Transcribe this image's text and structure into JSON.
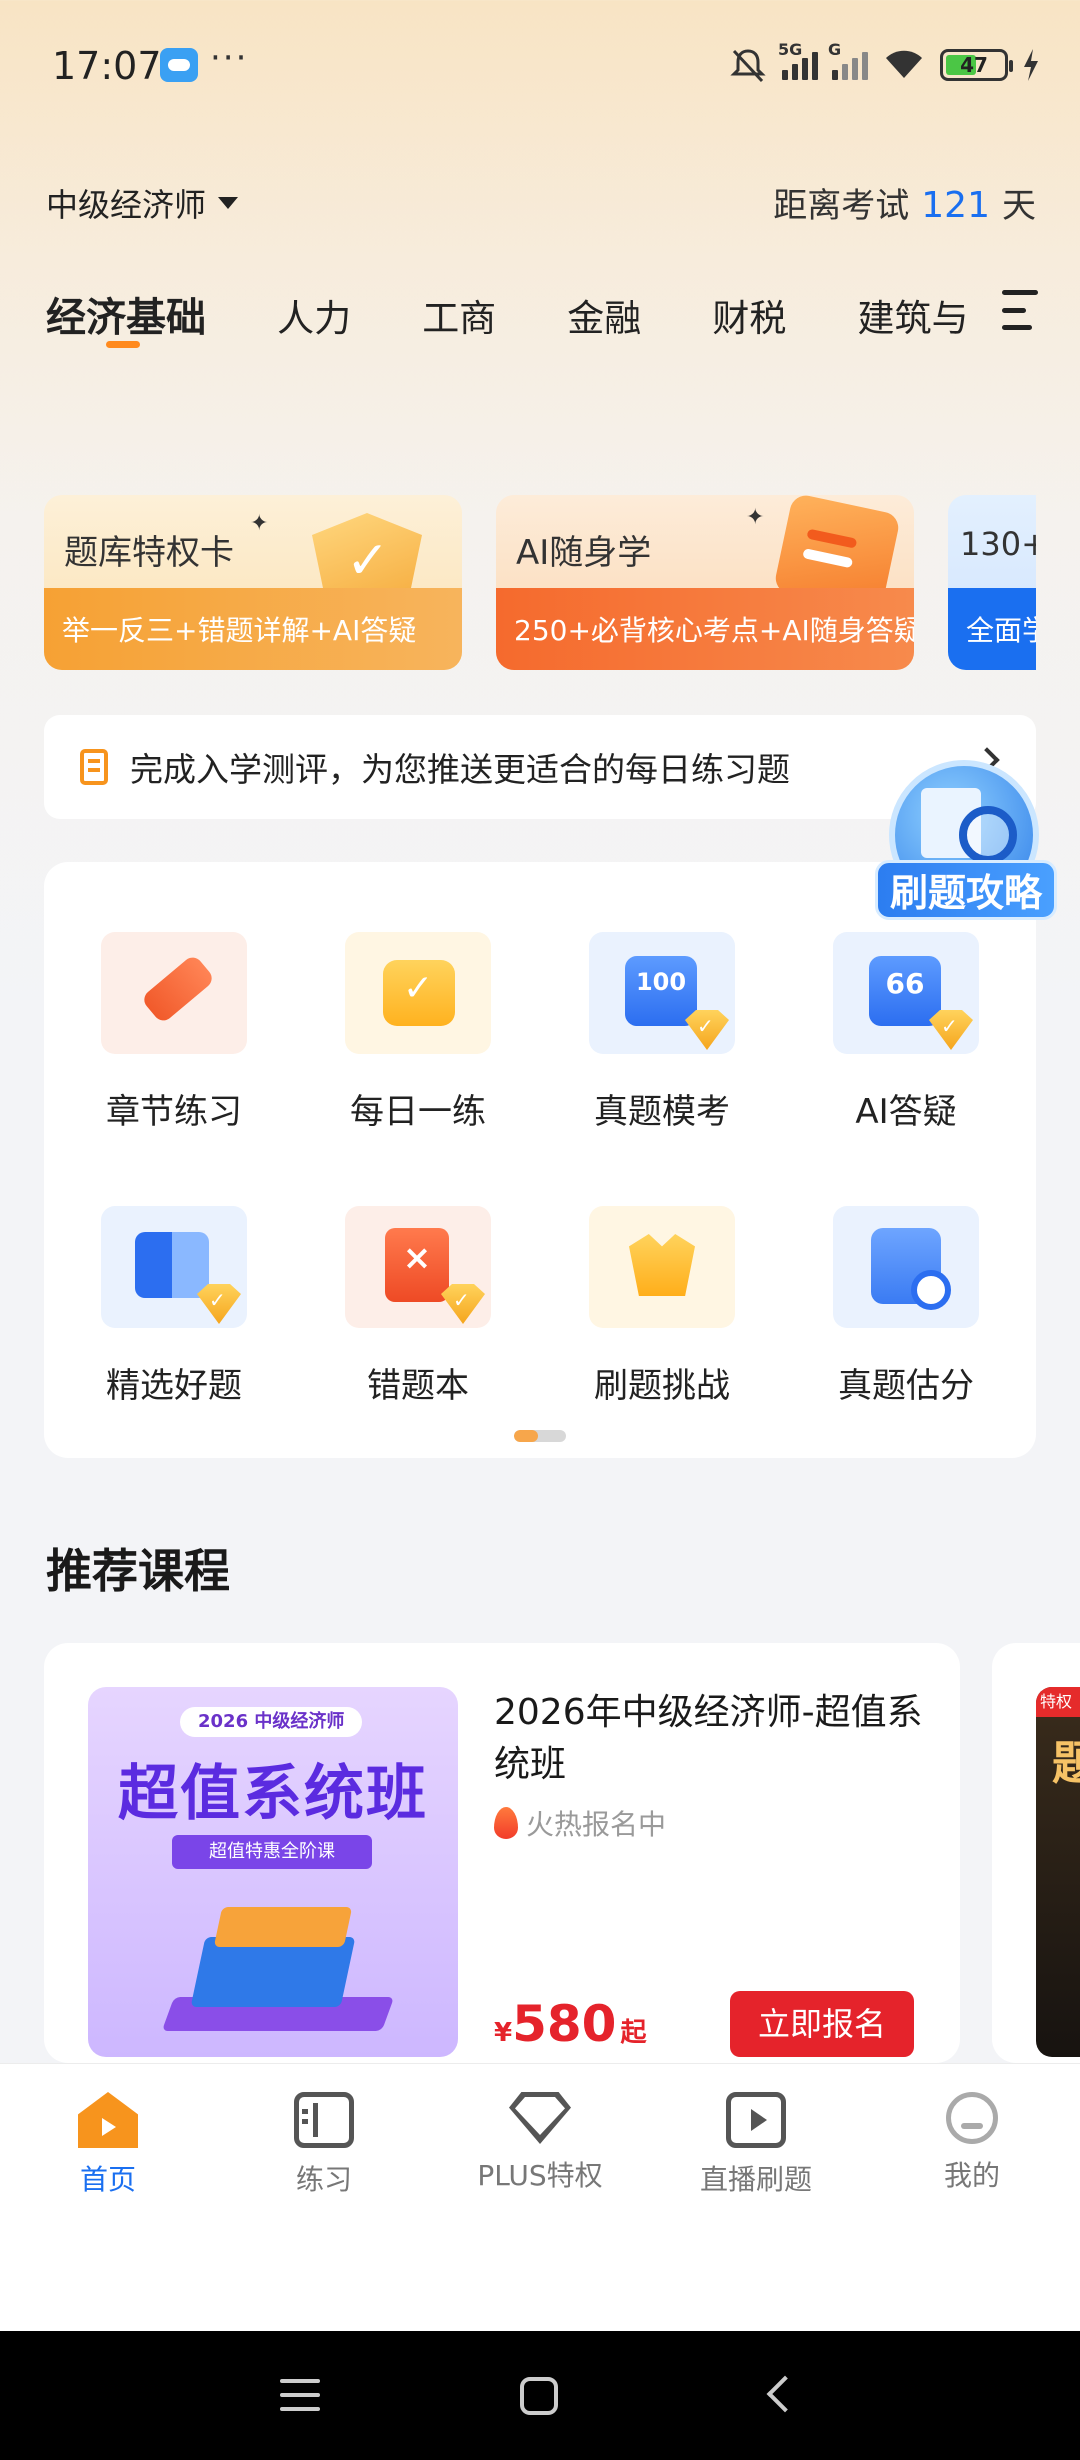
{
  "status_bar": {
    "time": "17:07",
    "more": "···",
    "network": "5G",
    "network2": "G",
    "battery": "47",
    "icons": [
      "cloud-icon",
      "mute-icon",
      "signal-icon",
      "wifi-icon",
      "battery-icon",
      "charging-icon"
    ]
  },
  "header": {
    "exam_name": "中级经济师",
    "countdown_prefix": "距离考试",
    "countdown_days": "121",
    "countdown_suffix": "天"
  },
  "subject_tabs": [
    "经济基础",
    "人力",
    "工商",
    "金融",
    "财税",
    "建筑与"
  ],
  "banners": [
    {
      "title": "题库特权卡",
      "subtitle": "举一反三+错题详解+AI答疑"
    },
    {
      "title": "AI随身学",
      "subtitle": "250+必背核心考点+AI随身答疑"
    },
    {
      "title": "130+",
      "subtitle": "全面学"
    }
  ],
  "assessment": {
    "text": "完成入学测评，为您推送更适合的每日练习题"
  },
  "float_badge": {
    "label": "刷题攻略"
  },
  "functions": [
    {
      "label": "章节练习",
      "icon": "pencil-icon"
    },
    {
      "label": "每日一练",
      "icon": "calendar-check-icon"
    },
    {
      "label": "真题模考",
      "icon": "exam-100-icon",
      "icon_text": "100"
    },
    {
      "label": "AI答疑",
      "icon": "ai-qa-icon",
      "icon_text": "66"
    },
    {
      "label": "精选好题",
      "icon": "book-icon"
    },
    {
      "label": "错题本",
      "icon": "wrong-book-icon",
      "icon_text": "×"
    },
    {
      "label": "刷题挑战",
      "icon": "crown-icon"
    },
    {
      "label": "真题估分",
      "icon": "checklist-search-icon"
    }
  ],
  "recommend": {
    "section_title": "推荐课程",
    "course": {
      "thumb_year": "2026  中级经济师",
      "thumb_title": "超值系统班",
      "thumb_sub": "超值特惠全阶课",
      "title": "2026年中级经济师-超值系统班",
      "status": "火热报名中",
      "currency": "¥",
      "price": "580",
      "price_suffix": "起",
      "enroll_label": "立即报名"
    },
    "next_course": {
      "tag": "特权",
      "title_char": "题"
    }
  },
  "tabbar": [
    {
      "label": "首页",
      "icon": "home-icon",
      "active": true
    },
    {
      "label": "练习",
      "icon": "practice-icon"
    },
    {
      "label": "PLUS特权",
      "icon": "diamond-icon"
    },
    {
      "label": "直播刷题",
      "icon": "live-play-icon"
    },
    {
      "label": "我的",
      "icon": "profile-icon"
    }
  ],
  "colors": {
    "accent_blue": "#1a6ff0",
    "accent_orange": "#f7941d",
    "price_red": "#e5232b"
  }
}
